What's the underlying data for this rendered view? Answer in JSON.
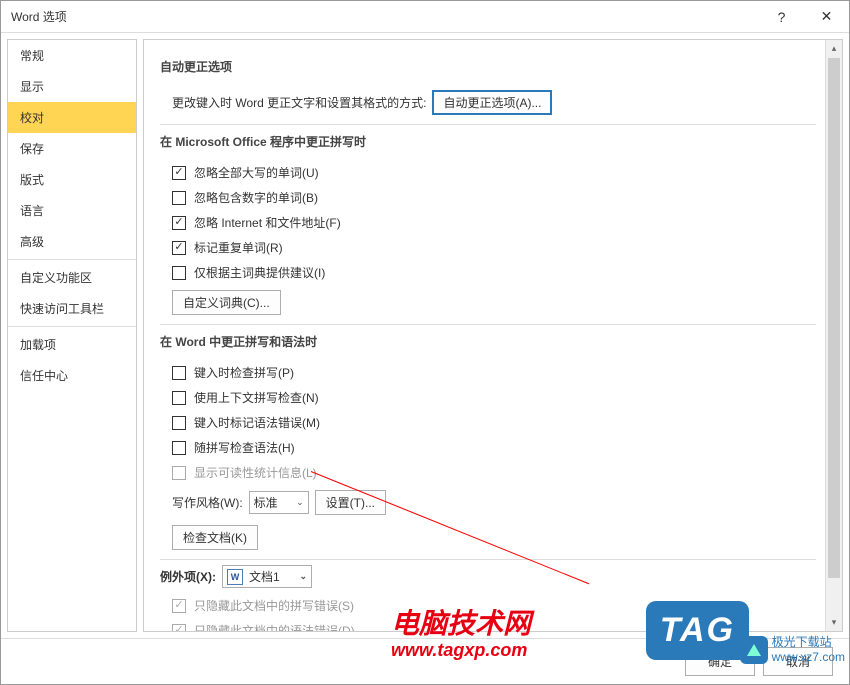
{
  "window": {
    "title": "Word 选项",
    "help": "?",
    "close": "✕"
  },
  "sidebar": {
    "items": [
      {
        "label": "常规",
        "selected": false
      },
      {
        "label": "显示",
        "selected": false
      },
      {
        "label": "校对",
        "selected": true
      },
      {
        "label": "保存",
        "selected": false
      },
      {
        "label": "版式",
        "selected": false
      },
      {
        "label": "语言",
        "selected": false
      },
      {
        "label": "高级",
        "selected": false
      }
    ],
    "items2": [
      {
        "label": "自定义功能区"
      },
      {
        "label": "快速访问工具栏"
      }
    ],
    "items3": [
      {
        "label": "加载项"
      },
      {
        "label": "信任中心"
      }
    ]
  },
  "content": {
    "section1": {
      "title": "自动更正选项",
      "desc": "更改键入时 Word 更正文字和设置其格式的方式:",
      "button": "自动更正选项(A)..."
    },
    "section2": {
      "title": "在 Microsoft Office 程序中更正拼写时",
      "checks": [
        {
          "label": "忽略全部大写的单词(U)",
          "checked": true
        },
        {
          "label": "忽略包含数字的单词(B)",
          "checked": false
        },
        {
          "label": "忽略 Internet 和文件地址(F)",
          "checked": true
        },
        {
          "label": "标记重复单词(R)",
          "checked": true
        },
        {
          "label": "仅根据主词典提供建议(I)",
          "checked": false
        }
      ],
      "dict_button": "自定义词典(C)..."
    },
    "section3": {
      "title": "在 Word 中更正拼写和语法时",
      "checks": [
        {
          "label": "键入时检查拼写(P)",
          "checked": false
        },
        {
          "label": "使用上下文拼写检查(N)",
          "checked": false
        },
        {
          "label": "键入时标记语法错误(M)",
          "checked": false
        },
        {
          "label": "随拼写检查语法(H)",
          "checked": false
        },
        {
          "label": "显示可读性统计信息(L)",
          "checked": false,
          "disabled": true
        }
      ],
      "style_label": "写作风格(W):",
      "style_value": "标准",
      "settings_button": "设置(T)...",
      "check_button": "检查文档(K)"
    },
    "section4": {
      "title_label": "例外项(X):",
      "doc_value": "文档1",
      "checks": [
        {
          "label": "只隐藏此文档中的拼写错误(S)",
          "checked": true,
          "disabled": true
        },
        {
          "label": "只隐藏此文档中的语法错误(D)",
          "checked": true,
          "disabled": true
        }
      ]
    }
  },
  "footer": {
    "ok": "确定",
    "cancel": "取消"
  },
  "watermark": {
    "line1": "电脑技术网",
    "line2": "www.tagxp.com",
    "tag": "TAG",
    "jiguang_name": "极光下载站",
    "jiguang_url": "www.xz7.com"
  }
}
